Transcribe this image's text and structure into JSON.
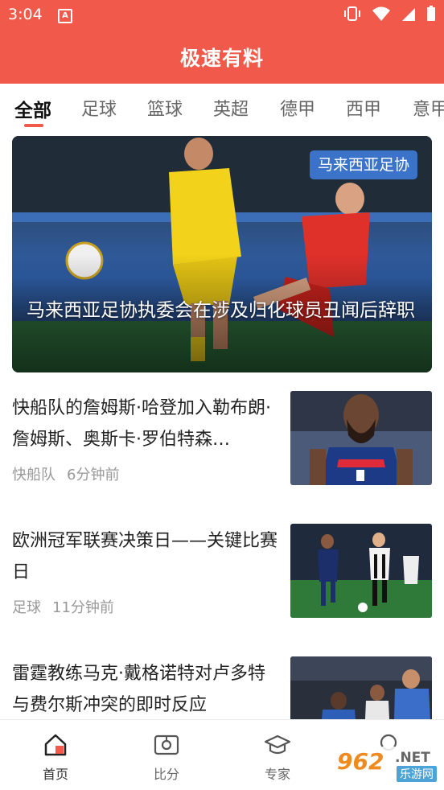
{
  "status_bar": {
    "time": "3:04",
    "notification_icon": "A",
    "icons": [
      "vibrate-icon",
      "wifi-icon",
      "signal-icon",
      "battery-icon"
    ]
  },
  "app": {
    "title": "极速有料",
    "accent_color": "#f15a4a"
  },
  "tabs": [
    {
      "label": "全部",
      "active": true
    },
    {
      "label": "足球"
    },
    {
      "label": "篮球"
    },
    {
      "label": "英超"
    },
    {
      "label": "德甲"
    },
    {
      "label": "西甲"
    },
    {
      "label": "意甲"
    }
  ],
  "hero": {
    "tag": "马来西亚足协",
    "title": "马来西亚足协执委会在涉及归化球员丑闻后辞职"
  },
  "news": [
    {
      "title": "快船队的詹姆斯·哈登加入勒布朗·詹姆斯、奥斯卡·罗伯特森…",
      "category": "快船队",
      "time": "6分钟前"
    },
    {
      "title": "欧洲冠军联赛决策日——关键比赛日",
      "category": "足球",
      "time": "11分钟前"
    },
    {
      "title": "雷霆教练马克·戴格诺特对卢多特与费尔斯冲突的即时反应",
      "category": "",
      "time": ""
    }
  ],
  "bottom_nav": [
    {
      "label": "首页",
      "icon": "home-icon",
      "active": true
    },
    {
      "label": "比分",
      "icon": "scoreboard-icon"
    },
    {
      "label": "专家",
      "icon": "graduation-cap-icon"
    },
    {
      "label": "",
      "icon": "profile-icon"
    }
  ],
  "watermark": {
    "number": "962",
    "suffix": ".NET",
    "site": "乐游网"
  }
}
